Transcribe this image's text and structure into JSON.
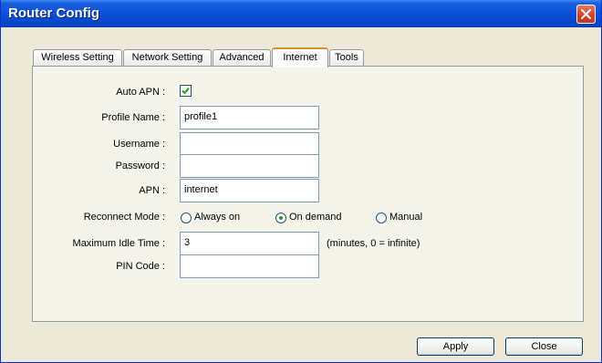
{
  "window": {
    "title": "Router Config"
  },
  "tabs": [
    {
      "label": "Wireless Setting"
    },
    {
      "label": "Network Setting"
    },
    {
      "label": "Advanced"
    },
    {
      "label": "Internet"
    },
    {
      "label": "Tools"
    }
  ],
  "active_tab": "Internet",
  "form": {
    "auto_apn": {
      "label": "Auto APN :",
      "checked": true
    },
    "profile_name": {
      "label": "Profile Name :",
      "value": "profile1"
    },
    "username": {
      "label": "Username :",
      "value": ""
    },
    "password": {
      "label": "Password :",
      "value": ""
    },
    "apn": {
      "label": "APN :",
      "value": "internet"
    },
    "reconnect_mode": {
      "label": "Reconnect Mode :",
      "options": [
        "Always on",
        "On demand",
        "Manual"
      ],
      "selected": "On demand"
    },
    "max_idle_time": {
      "label": "Maximum Idle Time :",
      "value": "3",
      "hint": "(minutes, 0 = infinite)"
    },
    "pin_code": {
      "label": "PIN Code :",
      "value": ""
    }
  },
  "buttons": {
    "apply": "Apply",
    "close": "Close"
  },
  "icons": {
    "close": "close-icon",
    "checkbox": "checkmark-icon"
  }
}
